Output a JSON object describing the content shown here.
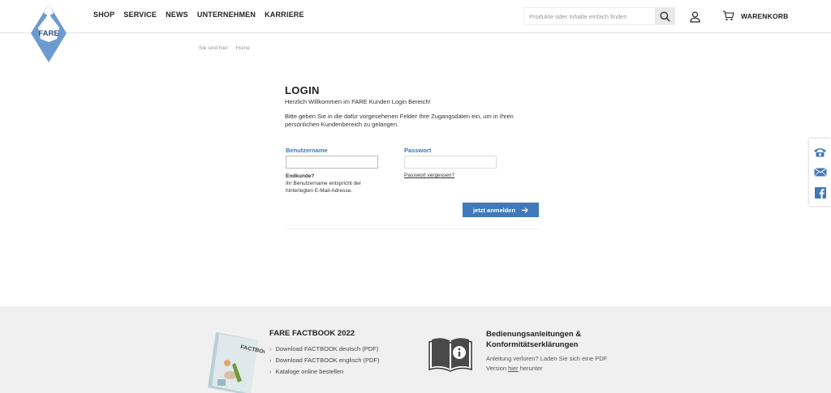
{
  "header": {
    "logo_text": "FARE",
    "nav": [
      "SHOP",
      "SERVICE",
      "NEWS",
      "UNTERNEHMEN",
      "KARRIERE"
    ],
    "search_placeholder": "Produkte oder Inhalte einfach finden",
    "cart_label": "WARENKORB"
  },
  "breadcrumb": {
    "prefix": "Sie sind hier:",
    "current": "Home"
  },
  "login": {
    "title": "LOGIN",
    "welcome": "Herzlich Willkommen im FARE Kunden Login Bereich!",
    "instructions": "Bitte geben Sie in die dafür vorgesehenen Felder Ihre Zugangsdaten ein, um in Ihren persönlichen Kundenbereich zu gelangen.",
    "username_label": "Benutzername",
    "password_label": "Passwort",
    "endkunde_title": "Endkunde?",
    "endkunde_text": "Ihr Benutzername entspricht der hinterlegten E-Mail-Adresse.",
    "forgot_link": "Passwort vergessen?",
    "submit_label": "jetzt anmelden"
  },
  "sidebar": {
    "icons": [
      "phone-icon",
      "mail-icon",
      "facebook-icon"
    ]
  },
  "footer": {
    "factbook": {
      "title": "FARE FACTBOOK 2022",
      "cover_text": "FACTBOOK",
      "links": [
        "Download FACTBOOK deutsch (PDF)",
        "Download FACTBOOK englisch (PDF)",
        "Kataloge online bestellen"
      ]
    },
    "manuals": {
      "title_line1": "Bedienungsanleitungen &",
      "title_line2": "Konformitätserklärungen",
      "text_before": "Anleitung verloren? Laden Sie sich eine PDF Version ",
      "link": "hier",
      "text_after": " herunter"
    }
  },
  "colors": {
    "brand_blue": "#3f79ba",
    "logo_blue": "#6d9bd1",
    "footer_bg": "#f0f0f0"
  }
}
